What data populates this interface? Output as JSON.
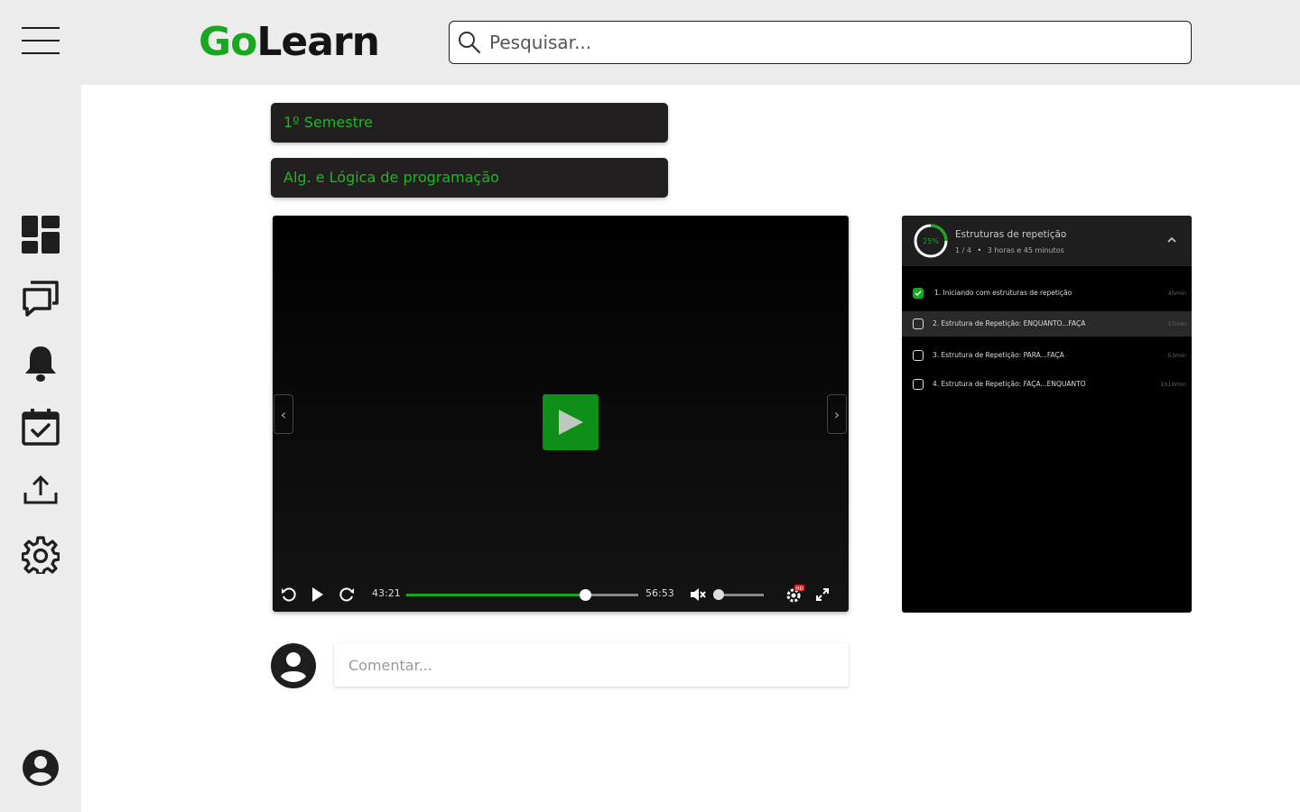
{
  "brand": {
    "go": "Go",
    "learn": "Learn"
  },
  "search": {
    "placeholder": "Pesquisar..."
  },
  "sidebar": {
    "icons": [
      "menu-icon",
      "dashboard-icon",
      "chat-icon",
      "bell-icon",
      "calendar-check-icon",
      "upload-icon",
      "gear-icon",
      "account-icon"
    ]
  },
  "filters": {
    "semester": "1º Semestre",
    "course": "Alg. e Lógica de programação"
  },
  "player": {
    "current_time": "43:21",
    "total_time": "56:53",
    "progress": 0.77,
    "volume": 0,
    "muted": true,
    "quality_badge": "HD"
  },
  "playlist": {
    "percent": "25%",
    "progress": 0.25,
    "title": "Estruturas de repetição",
    "count": "1 / 4",
    "duration": "3 horas e 45 minutos",
    "items": [
      {
        "label": "1. Iniciando com estruturas de repetição",
        "duration": "45min",
        "done": true
      },
      {
        "label": "2. Estrutura de Repetição: ENQUANTO...FAÇA",
        "duration": "57min",
        "done": false
      },
      {
        "label": "3. Estrutura de Repetição: PARA...FAÇA",
        "duration": "53min",
        "done": false
      },
      {
        "label": "4. Estrutura de Repetição: FAÇA...ENQUANTO",
        "duration": "1h10min",
        "done": false
      }
    ]
  },
  "comment": {
    "placeholder": "Comentar..."
  },
  "colors": {
    "accent": "#18a81f",
    "dark": "#231f20"
  }
}
